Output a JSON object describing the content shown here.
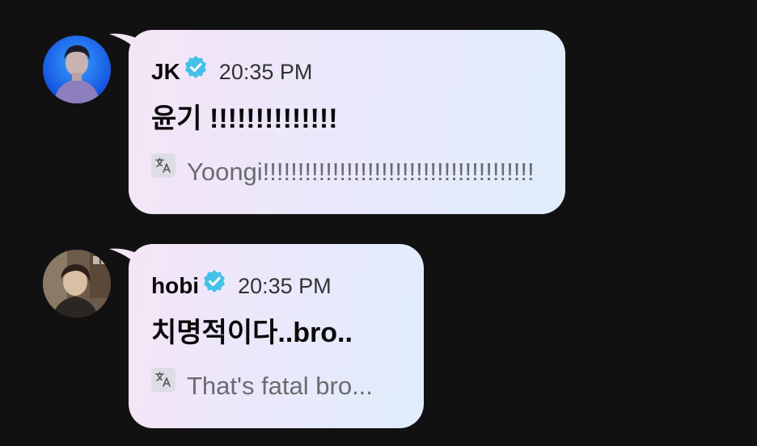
{
  "messages": [
    {
      "sender": "JK",
      "verified_icon": "verified-badge-icon",
      "time": "20:35 PM",
      "text": "윤기 !!!!!!!!!!!!!!",
      "translate_icon": "translate-icon",
      "translation": "Yoongi!!!!!!!!!!!!!!!!!!!!!!!!!!!!!!!!!!!!!!!",
      "avatar_icon": "avatar-jk"
    },
    {
      "sender": "hobi",
      "verified_icon": "verified-badge-icon",
      "time": "20:35 PM",
      "text": "치명적이다..bro..",
      "translate_icon": "translate-icon",
      "translation": "That's fatal bro...",
      "avatar_icon": "avatar-hobi"
    }
  ],
  "colors": {
    "background": "#121112",
    "verified": "#45c1e8",
    "bubble_start": "#f4e5f6",
    "bubble_end": "#dfedfb"
  }
}
